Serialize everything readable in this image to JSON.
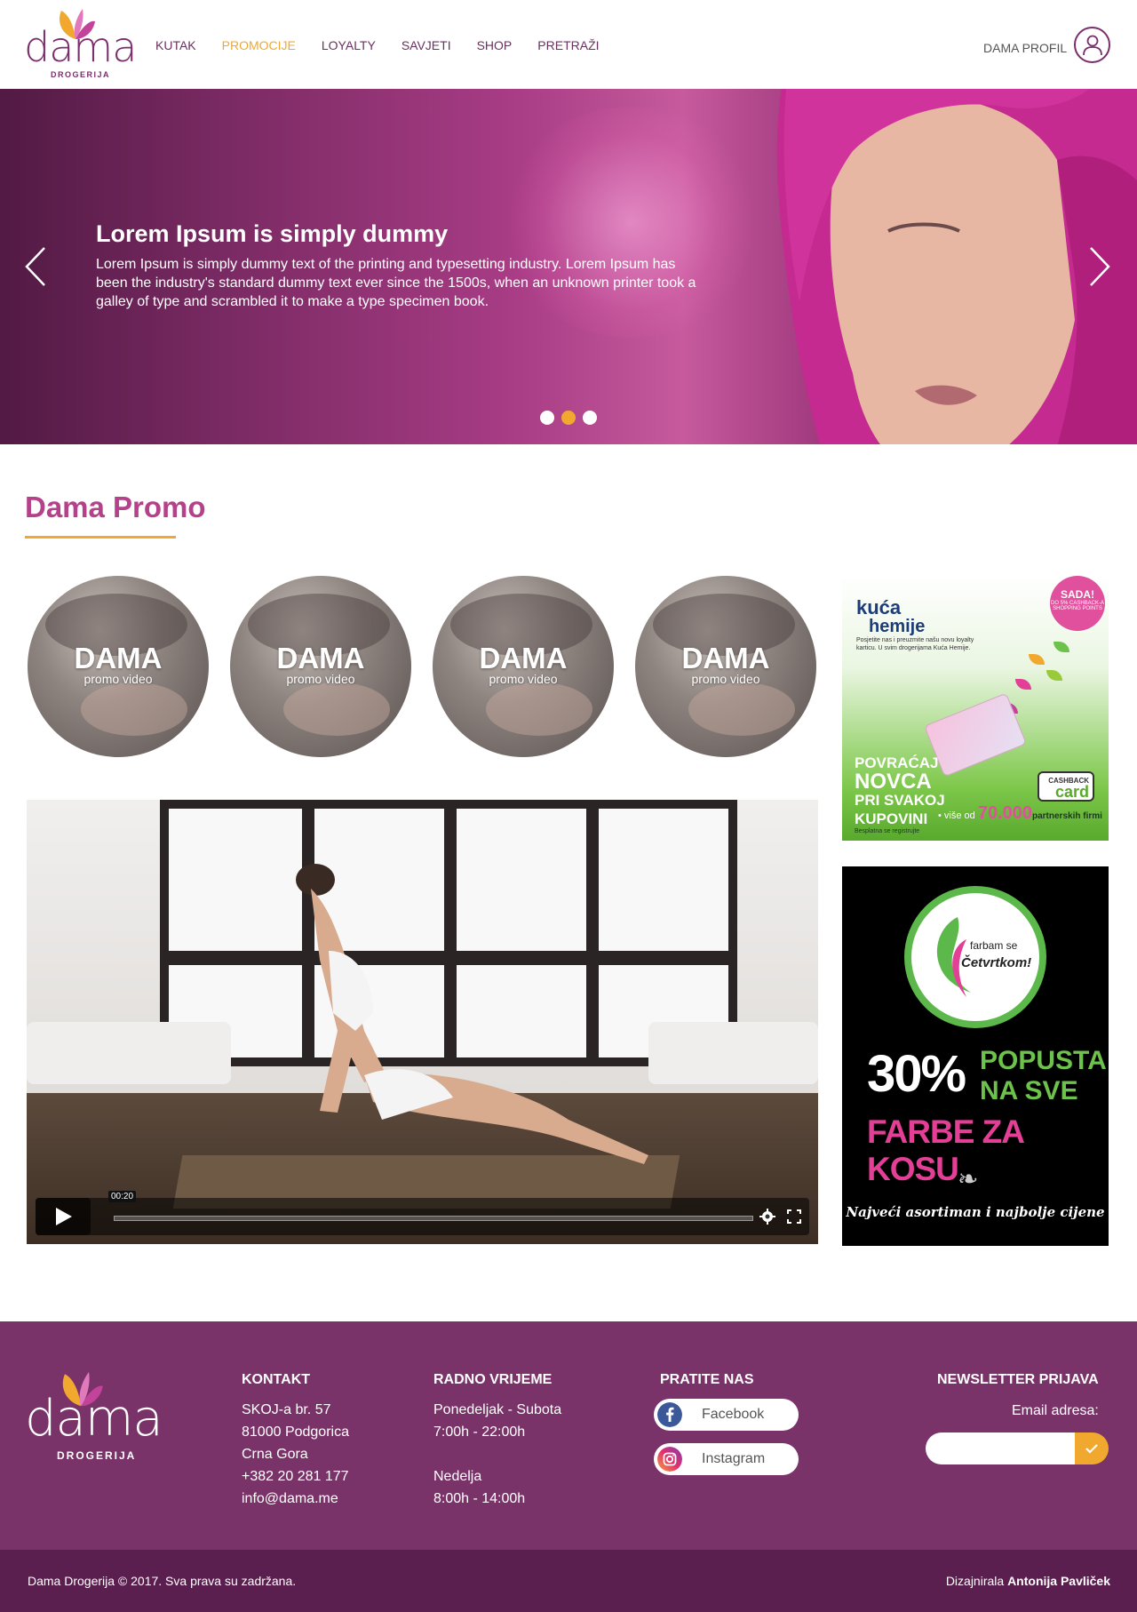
{
  "brand": {
    "name": "dama",
    "sub": "DROGERIJA"
  },
  "nav": {
    "items": [
      {
        "label": "KUTAK",
        "active": false
      },
      {
        "label": "PROMOCIJE",
        "active": true
      },
      {
        "label": "LOYALTY",
        "active": false
      },
      {
        "label": "SAVJETI",
        "active": false
      },
      {
        "label": "SHOP",
        "active": false
      },
      {
        "label": "PRETRAŽI",
        "active": false
      }
    ],
    "profile_label": "DAMA PROFIL",
    "profile_icon": "user-icon"
  },
  "hero": {
    "title": "Lorem Ipsum is simply dummy",
    "text": "Lorem Ipsum is simply dummy text of the printing and typesetting industry. Lorem Ipsum has been the industry's standard dummy text ever since the 1500s, when an unknown printer took a galley of type and scrambled it to make a type specimen book.",
    "slide_count": 3,
    "active_slide": 2
  },
  "promo": {
    "title": "Dama Promo",
    "videos": [
      {
        "title": "DAMA",
        "subtitle": "promo video"
      },
      {
        "title": "DAMA",
        "subtitle": "promo video"
      },
      {
        "title": "DAMA",
        "subtitle": "promo video"
      },
      {
        "title": "DAMA",
        "subtitle": "promo video"
      }
    ],
    "player": {
      "time": "00:20"
    }
  },
  "ad_cashback": {
    "brand_line1": "kuća",
    "brand_line2": "hemije",
    "tagline": "Posjetite nas i preuzmite našu novu loyalty karticu. U svim drogerijama Kuća Hemije.",
    "badge_main": "SADA!",
    "badge_sub": "DO 5% CASHBACK-A SHOPPING POINTS",
    "line1": "POVRAĆAJ",
    "line2": "NOVCA",
    "line3": "PRI SVAKOJ",
    "line4": "KUPOVINI",
    "free_reg": "Besplatna se registrujte",
    "more_than": "• više od",
    "number": "70.000",
    "partners": "partnerskih firmi",
    "card_label": "CASHBACK",
    "card_word": "card"
  },
  "ad_color": {
    "badge_line1": "farbam se",
    "badge_line2": "Četvrtkom!",
    "percent": "30%",
    "line1": "POPUSTA",
    "line2": "NA SVE",
    "line3": "FARBE ZA KOSU",
    "slogan": "Najveći asortiman i najbolje cijene"
  },
  "footer": {
    "contact": {
      "title": "KONTAKT",
      "lines": [
        "SKOJ-a br. 57",
        "81000 Podgorica",
        "Crna Gora",
        "+382 20 281 177",
        "info@dama.me"
      ]
    },
    "hours": {
      "title": "RADNO VRIJEME",
      "lines": [
        "Ponedeljak - Subota",
        "7:00h - 22:00h",
        "",
        "Nedelja",
        "8:00h - 14:00h"
      ]
    },
    "social": {
      "title": "PRATITE NAS",
      "facebook": "Facebook",
      "instagram": "Instagram"
    },
    "newsletter": {
      "title": "NEWSLETTER PRIJAVA",
      "email_label": "Email adresa:",
      "email_value": "",
      "email_placeholder": ""
    },
    "copyright": "Dama Drogerija © 2017. Sva prava su zadržana.",
    "designer_prefix": "Dizajnirala",
    "designer_name": "Antonija Pavliček"
  },
  "colors": {
    "brand_purple": "#7a3369",
    "accent_orange": "#f0a92e",
    "title_pink": "#b5418b"
  }
}
